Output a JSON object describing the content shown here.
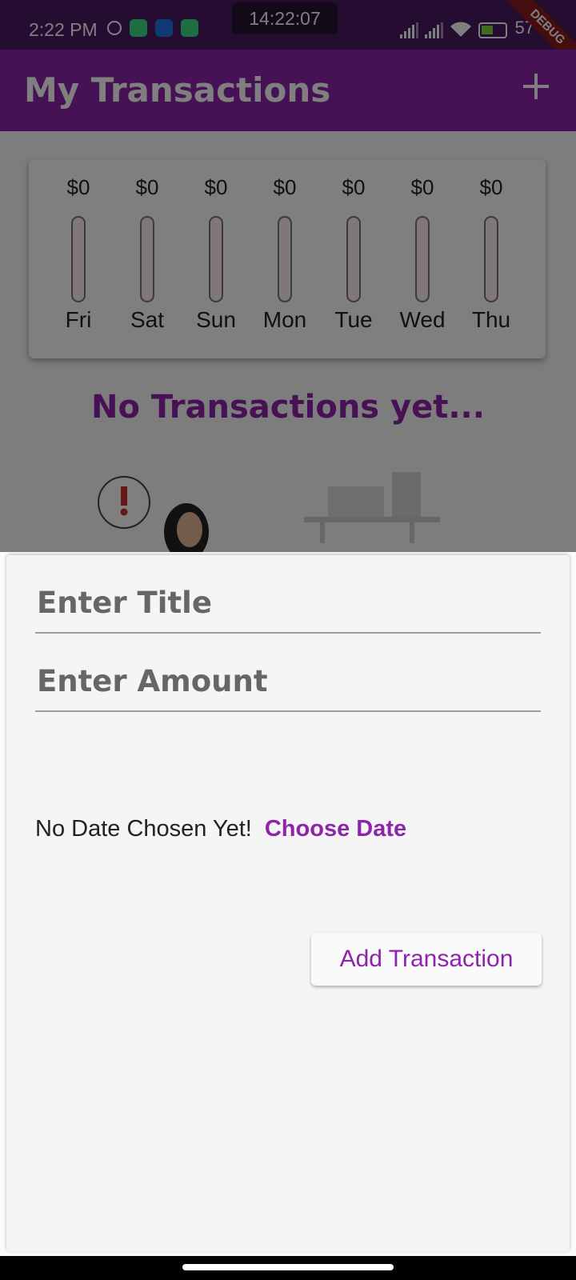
{
  "status_bar": {
    "time": "2:22 PM",
    "clock_overlay": "14:22:07",
    "battery_text": "57",
    "debug_banner": "DEBUG"
  },
  "app_bar": {
    "title": "My Transactions",
    "add_icon": "plus-icon"
  },
  "chart": {
    "days": [
      {
        "day": "Fri",
        "amount": "$0",
        "fill": 0
      },
      {
        "day": "Sat",
        "amount": "$0",
        "fill": 0
      },
      {
        "day": "Sun",
        "amount": "$0",
        "fill": 0
      },
      {
        "day": "Mon",
        "amount": "$0",
        "fill": 0
      },
      {
        "day": "Tue",
        "amount": "$0",
        "fill": 0
      },
      {
        "day": "Wed",
        "amount": "$0",
        "fill": 0
      },
      {
        "day": "Thu",
        "amount": "$0",
        "fill": 0
      }
    ]
  },
  "empty_state": {
    "message": "No Transactions yet..."
  },
  "sheet": {
    "title_placeholder": "Enter Title",
    "amount_placeholder": "Enter Amount",
    "date_text": "No Date Chosen Yet!",
    "choose_date_label": "Choose Date",
    "submit_label": "Add Transaction"
  },
  "colors": {
    "primary": "#8e24aa",
    "status_bar": "#4a1a63"
  }
}
